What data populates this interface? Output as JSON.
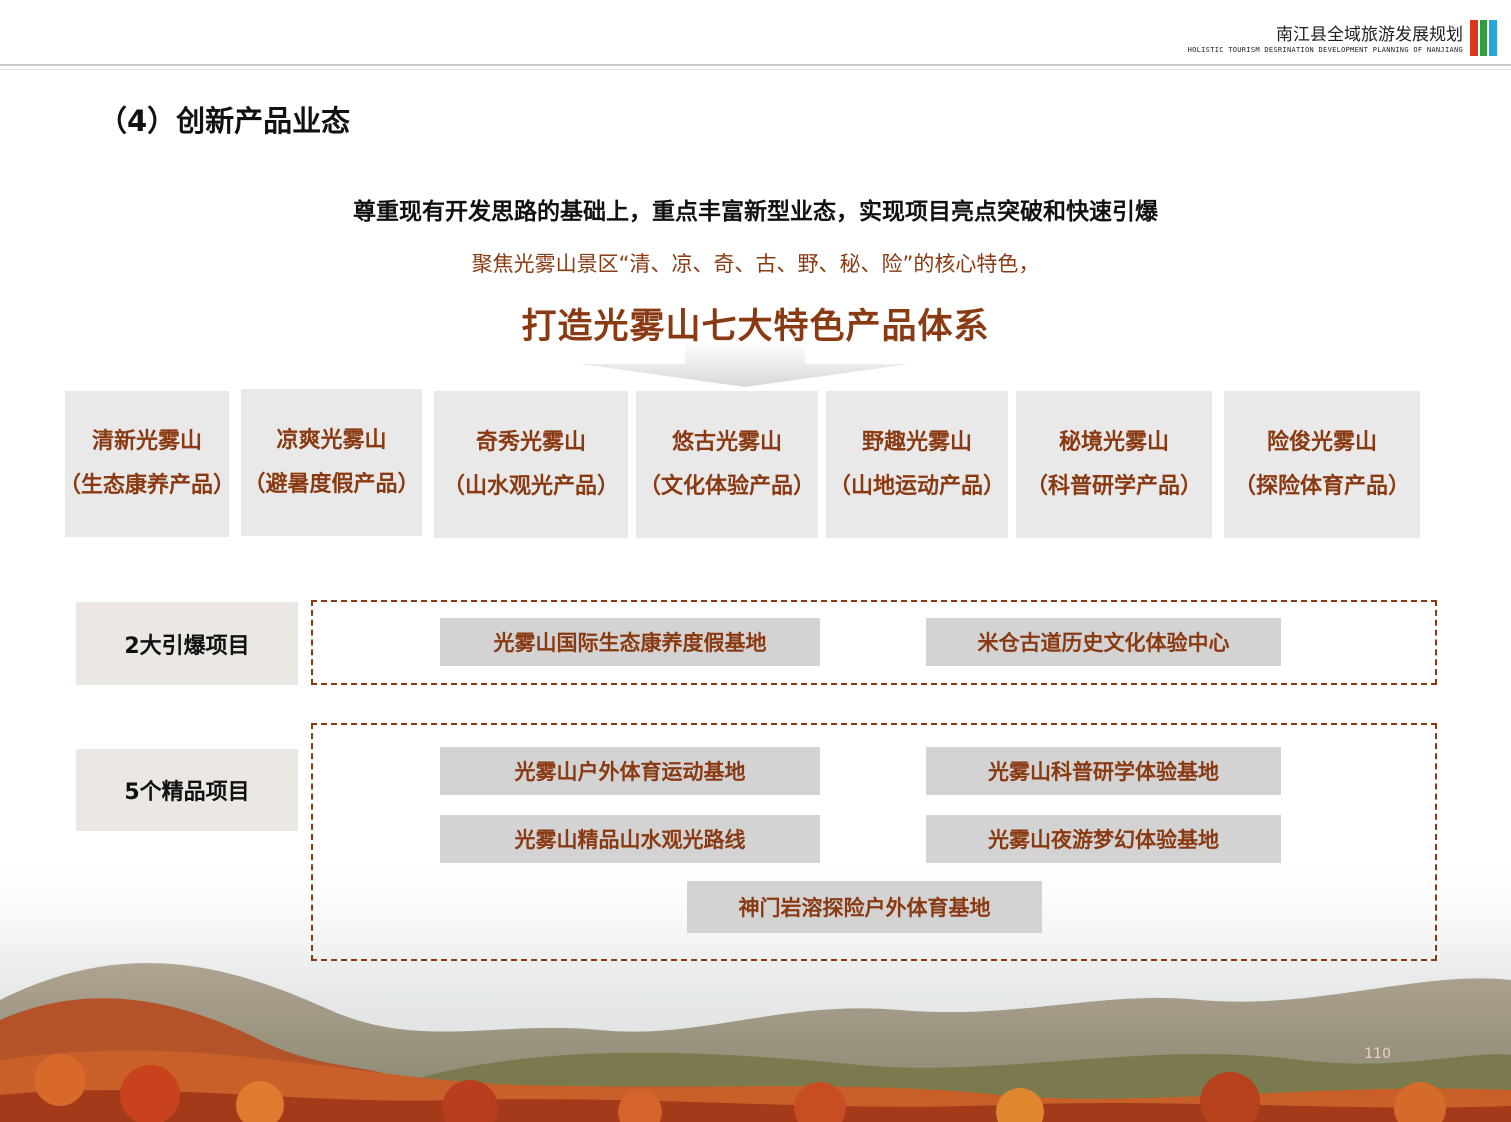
{
  "header": {
    "title": "南江县全域旅游发展规划",
    "subtitle": "HOLISTIC TOURISM DESRINATION DEVELOPMENT PLANNING OF NANJIANG",
    "bar_colors": [
      "#d9381e",
      "#2e9e3e",
      "#28a7d8"
    ]
  },
  "section_title": "（4）创新产品业态",
  "headline": "尊重现有开发思路的基础上，重点丰富新型业态，实现项目亮点突破和快速引爆",
  "subline": "聚焦光雾山景区“清、凉、奇、古、野、秘、险”的核心特色，",
  "bigline": "打造光雾山七大特色产品体系",
  "products": [
    {
      "name": "清新光雾山",
      "type": "（生态康养产品）"
    },
    {
      "name": "凉爽光雾山",
      "type": "（避暑度假产品）"
    },
    {
      "name": "奇秀光雾山",
      "type": "（山水观光产品）"
    },
    {
      "name": "悠古光雾山",
      "type": "（文化体验产品）"
    },
    {
      "name": "野趣光雾山",
      "type": "（山地运动产品）"
    },
    {
      "name": "秘境光雾山",
      "type": "（科普研学产品）"
    },
    {
      "name": "险俊光雾山",
      "type": "（探险体育产品）"
    }
  ],
  "groups": {
    "major": {
      "label": "2大引爆项目",
      "items": [
        "光雾山国际生态康养度假基地",
        "米仓古道历史文化体验中心"
      ]
    },
    "premium": {
      "label": "5个精品项目",
      "items": [
        "光雾山户外体育运动基地",
        "光雾山科普研学体验基地",
        "光雾山精品山水观光路线",
        "光雾山夜游梦幻体验基地",
        "神门岩溶探险户外体育基地"
      ]
    }
  },
  "page_number": "110",
  "colors": {
    "accent": "#8a3a12",
    "card_bg": "#e9e9e9",
    "pill_bg": "#d3d3d3",
    "label_bg": "#ebe7e3"
  }
}
